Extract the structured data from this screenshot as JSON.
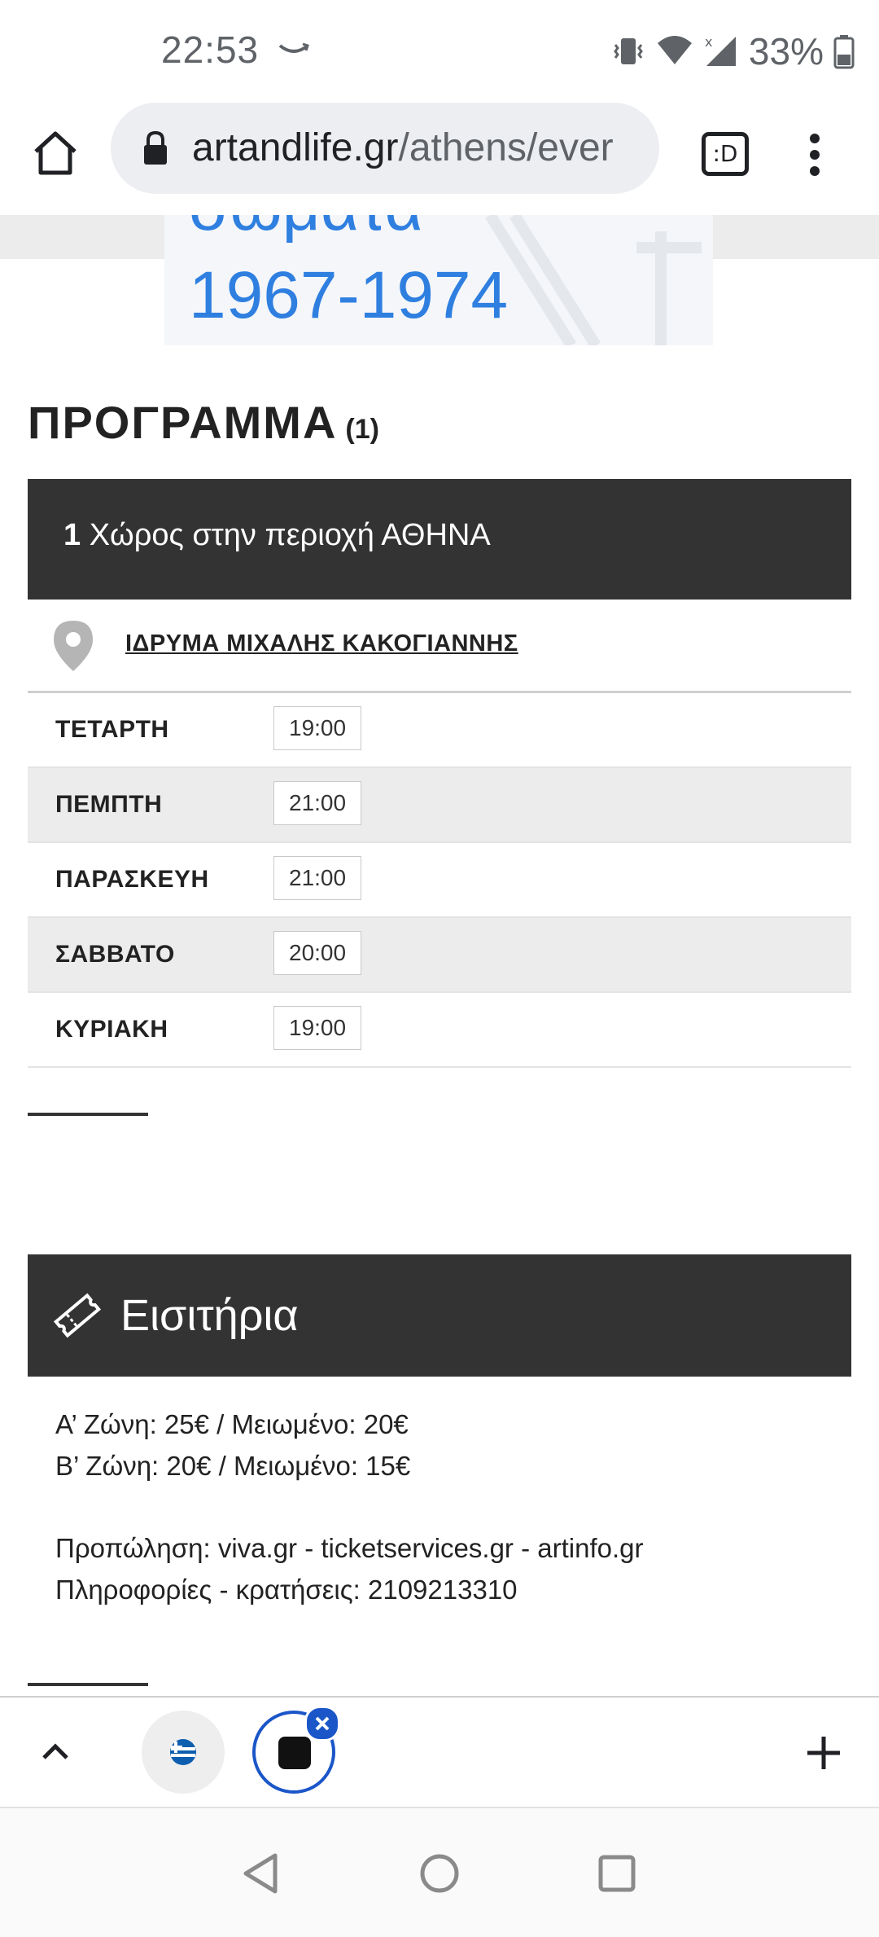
{
  "status_bar": {
    "time": "22:53",
    "battery": "33%"
  },
  "browser": {
    "url_host": "artandlife.gr",
    "url_path": "/athens/ever",
    "tab_switcher_label": ":D"
  },
  "banner": {
    "line1": "σώματα",
    "line2": "1967-1974"
  },
  "program": {
    "title": "ΠΡΟΓΡΑΜΜΑ",
    "count": "(1)",
    "venue_count": "1",
    "venue_area_text": " Χώρος στην περιοχή ΑΘΗΝΑ",
    "venue_name": "ΙΔΡΥΜΑ ΜΙΧΑΛΗΣ ΚΑΚΟΓΙΑΝΝΗΣ",
    "schedule": [
      {
        "day": "ΤΕΤΑΡΤΗ",
        "time": "19:00"
      },
      {
        "day": "ΠΕΜΠΤΗ",
        "time": "21:00"
      },
      {
        "day": "ΠΑΡΑΣΚΕΥΗ",
        "time": "21:00"
      },
      {
        "day": "ΣΑΒΒΑΤΟ",
        "time": "20:00"
      },
      {
        "day": "ΚΥΡΙΑΚΗ",
        "time": "19:00"
      }
    ]
  },
  "tickets": {
    "title": "Εισιτήρια",
    "zone_a": "Α’ Ζώνη: 25€ / Μειωμένο: 20€",
    "zone_b": "Β’ Ζώνη: 20€ / Μειωμένο: 15€",
    "presale": "Προπώληση: viva.gr - ticketservices.gr - artinfo.gr",
    "info": "Πληροφορίες - κρατήσεις: 2109213310"
  },
  "icons": {
    "home": "home-icon",
    "lock": "lock-icon",
    "menu": "more-vert-icon",
    "pin": "location-pin-icon",
    "ticket": "ticket-icon"
  },
  "colors": {
    "dark_bar": "#333333",
    "banner_text": "#2f7fe0",
    "active_tab_ring": "#1a56c8"
  }
}
